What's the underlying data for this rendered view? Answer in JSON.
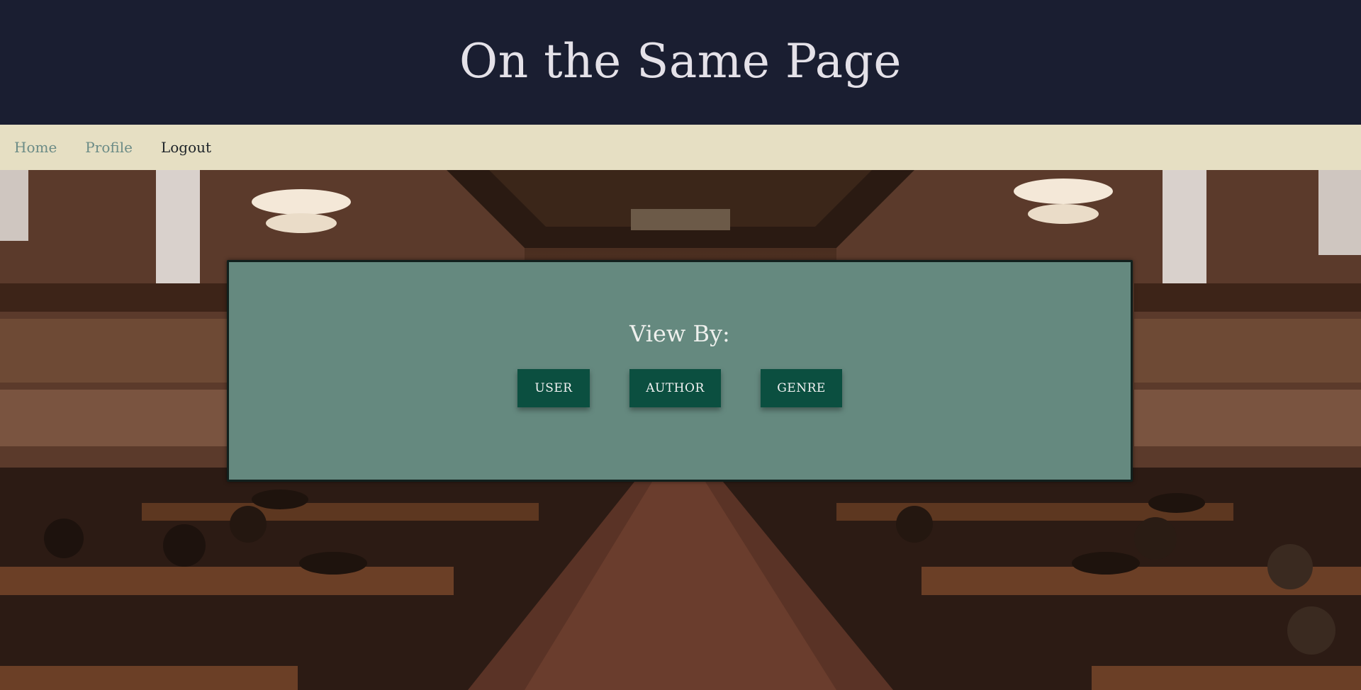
{
  "header": {
    "title": "On the Same Page"
  },
  "nav": {
    "items": [
      {
        "label": "Home"
      },
      {
        "label": "Profile"
      },
      {
        "label": "Logout"
      }
    ]
  },
  "panel": {
    "heading": "View By:",
    "buttons": [
      {
        "label": "USER"
      },
      {
        "label": "AUTHOR"
      },
      {
        "label": "GENRE"
      }
    ]
  },
  "colors": {
    "header_bg": "#1a1e31",
    "nav_bg": "#e6dfc3",
    "panel_bg": "#65897f",
    "button_bg": "#0b4f40",
    "nav_link": "#6b8b86"
  },
  "background": {
    "icon": "library-reading-room-photo"
  }
}
